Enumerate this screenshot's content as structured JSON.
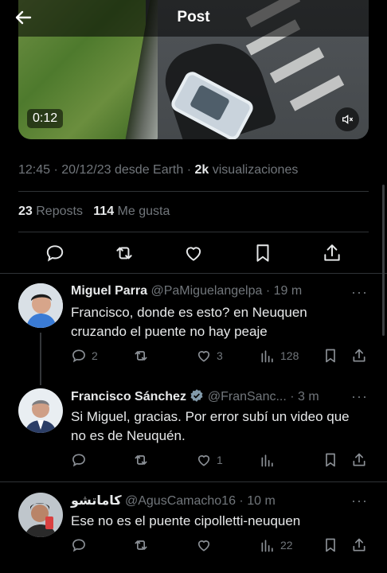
{
  "header": {
    "title": "Post",
    "back_icon": "arrow-left-icon"
  },
  "video": {
    "duration": "0:12",
    "mute_icon": "volume-muted-icon"
  },
  "post_meta": {
    "time": "12:45",
    "date_text": " · 20/12/23 desde Earth · ",
    "views_count": "2k",
    "views_label": " visualizaciones"
  },
  "post_stats": {
    "reposts_count": "23",
    "reposts_label": " Reposts",
    "likes_count": "114",
    "likes_label": " Me gusta"
  },
  "post_actions": [
    "reply-icon",
    "repost-icon",
    "like-icon",
    "bookmark-icon",
    "share-icon"
  ],
  "replies": [
    {
      "name": "Miguel Parra",
      "handle": " @PaMiguelangelpa",
      "time": " · 19 m",
      "text": "Francisco, donde es esto? en Neuquen cruzando el puente no hay peaje",
      "replies": "2",
      "reposts": "",
      "likes": "3",
      "views": "128"
    },
    {
      "name": "Francisco Sánchez",
      "handle": " @FranSanc...",
      "time": " · 3 m",
      "text": "Si Miguel, gracias. Por error subí un video que no es de Neuquén.",
      "replies": "",
      "reposts": "",
      "likes": "1",
      "views": "",
      "verified": true
    },
    {
      "name": "كاماتشو",
      "handle": " @AgusCamacho16",
      "time": " · 10 m",
      "text": "Ese no es el puente cipolletti-neuquen",
      "replies": "",
      "reposts": "",
      "likes": "",
      "views": "22"
    }
  ],
  "colors": {
    "background": "#000000",
    "text": "#e7e9ea",
    "muted": "#71767b",
    "divider": "#2f3336",
    "verified": "#829aab"
  }
}
